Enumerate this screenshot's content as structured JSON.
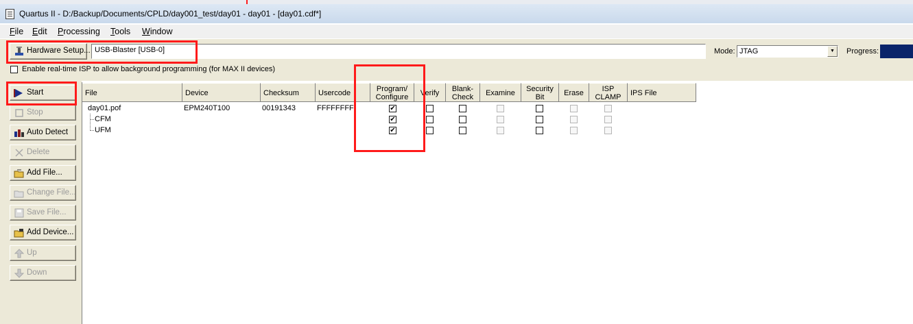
{
  "window": {
    "title": "Quartus II - D:/Backup/Documents/CPLD/day001_test/day01 - day01 - [day01.cdf*]"
  },
  "menu": [
    {
      "label": "File",
      "mnemonic": "F",
      "rest": "ile"
    },
    {
      "label": "Edit",
      "mnemonic": "E",
      "rest": "dit"
    },
    {
      "label": "Processing",
      "mnemonic": "P",
      "rest": "rocessing"
    },
    {
      "label": "Tools",
      "mnemonic": "T",
      "rest": "ools"
    },
    {
      "label": "Window",
      "mnemonic": "W",
      "rest": "indow"
    }
  ],
  "toolbar": {
    "hardware_setup_label": "Hardware Setup...",
    "hardware_value": "USB-Blaster [USB-0]",
    "mode_label": "Mode:",
    "mode_value": "JTAG",
    "progress_label": "Progress:",
    "progress_value": 1.0
  },
  "isp": {
    "label": "Enable real-time ISP to allow background programming (for MAX II devices)",
    "checked": false
  },
  "side_buttons": [
    {
      "label": "Start",
      "icon": "start-icon",
      "enabled": true
    },
    {
      "label": "Stop",
      "icon": "stop-icon",
      "enabled": false
    },
    {
      "label": "Auto Detect",
      "icon": "auto-detect-icon",
      "enabled": true
    },
    {
      "label": "Delete",
      "icon": "delete-icon",
      "enabled": false
    },
    {
      "label": "Add File...",
      "icon": "add-file-icon",
      "enabled": true
    },
    {
      "label": "Change File...",
      "icon": "change-file-icon",
      "enabled": false
    },
    {
      "label": "Save File...",
      "icon": "save-file-icon",
      "enabled": false
    },
    {
      "label": "Add Device...",
      "icon": "add-device-icon",
      "enabled": true
    },
    {
      "label": "Up",
      "icon": "up-icon",
      "enabled": false
    },
    {
      "label": "Down",
      "icon": "down-icon",
      "enabled": false
    }
  ],
  "columns": {
    "file": "File",
    "device": "Device",
    "checksum": "Checksum",
    "usercode": "Usercode",
    "program_1": "Program/",
    "program_2": "Configure",
    "verify": "Verify",
    "blank_1": "Blank-",
    "blank_2": "Check",
    "examine": "Examine",
    "security_1": "Security",
    "security_2": "Bit",
    "erase": "Erase",
    "isp_1": "ISP",
    "isp_2": "CLAMP",
    "ips_file": "IPS File"
  },
  "rows": [
    {
      "file": "day01.pof",
      "device": "EPM240T100",
      "checksum": "00191343",
      "usercode": "FFFFFFFF",
      "program": true,
      "verify": false,
      "blank_check": false,
      "examine": false,
      "security_bit": false,
      "erase": false,
      "isp_clamp": false
    },
    {
      "file": "CFM",
      "device": "",
      "checksum": "",
      "usercode": "",
      "program": true,
      "verify": false,
      "blank_check": false,
      "examine": false,
      "security_bit": false,
      "erase": false,
      "isp_clamp": false
    },
    {
      "file": "UFM",
      "device": "",
      "checksum": "",
      "usercode": "",
      "program": true,
      "verify": false,
      "blank_check": false,
      "examine": false,
      "security_bit": false,
      "erase": false,
      "isp_clamp": false
    }
  ],
  "colors": {
    "highlight": "#ff1a1a",
    "progress_fill": "#0a246a",
    "panel": "#ece9d8"
  }
}
